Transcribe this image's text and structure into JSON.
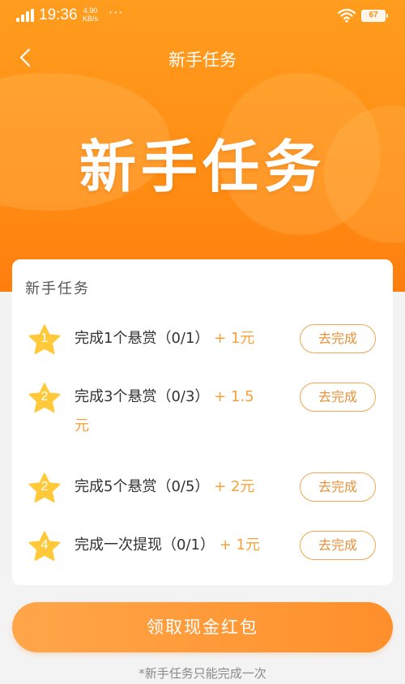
{
  "status_bar": {
    "time": "19:36",
    "speed_value": "4.90",
    "speed_unit": "KB/s",
    "dots": "···",
    "battery": "67"
  },
  "nav": {
    "title": "新手任务"
  },
  "hero": {
    "title": "新手任务"
  },
  "card": {
    "title": "新手任务",
    "tasks": [
      {
        "num": "1",
        "text": "完成1个悬赏（0/1）",
        "reward": "+ 1元",
        "button": "去完成"
      },
      {
        "num": "2",
        "text": "完成3个悬赏（0/3）",
        "reward": "+ 1.5元",
        "button": "去完成"
      },
      {
        "num": "2",
        "text": "完成5个悬赏（0/5）",
        "reward": "+ 2元",
        "button": "去完成"
      },
      {
        "num": "4",
        "text": "完成一次提现（0/1）",
        "reward": "+ 1元",
        "button": "去完成"
      }
    ]
  },
  "main_button": "领取现金红包",
  "footnote": "*新手任务只能完成一次",
  "colors": {
    "accent": "#ff8c14",
    "reward": "#f7a13a",
    "star": "#ffc93a"
  }
}
